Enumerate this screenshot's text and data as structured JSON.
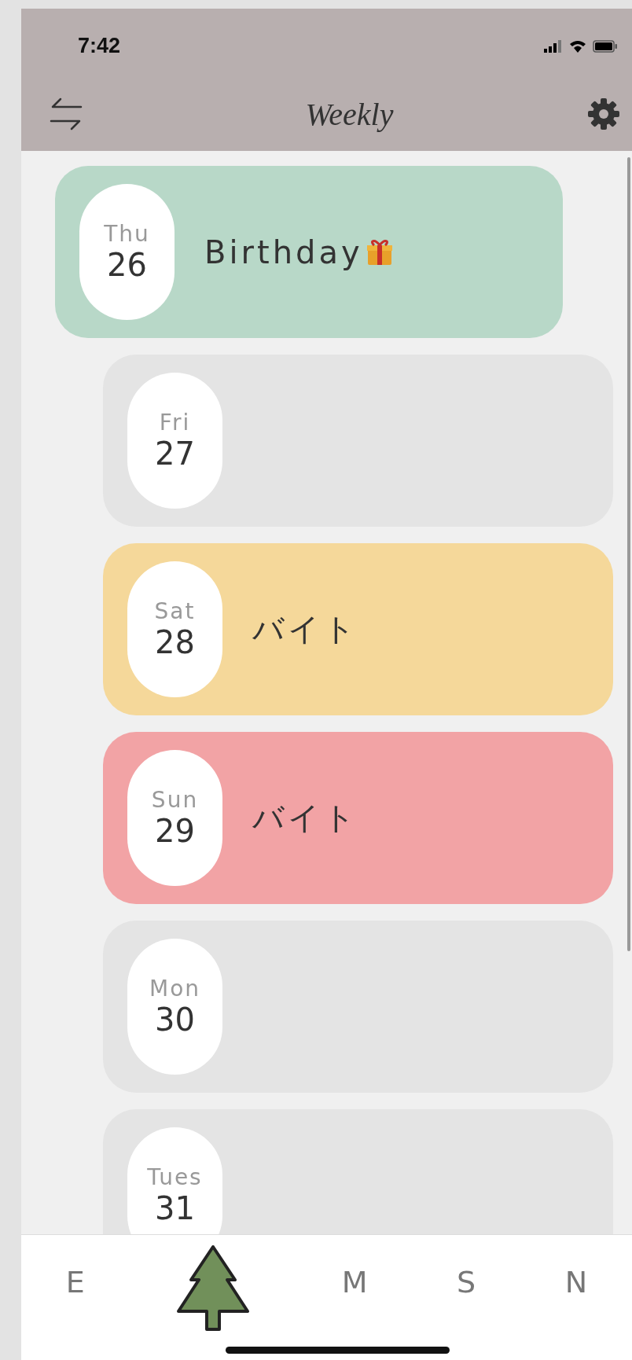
{
  "status_bar": {
    "time": "7:42"
  },
  "header": {
    "title": "Weekly"
  },
  "days": [
    {
      "day": "Thu",
      "date": "26",
      "note": "Birthday",
      "gift": true,
      "color": "#b8d8c8",
      "selected": true
    },
    {
      "day": "Fri",
      "date": "27",
      "color": "#e4e4e4",
      "selected": false
    },
    {
      "day": "Sat",
      "date": "28",
      "note": "バイト",
      "color": "#f5d89a",
      "selected": false
    },
    {
      "day": "Sun",
      "date": "29",
      "note": "バイト",
      "color": "#f2a3a5",
      "selected": false
    },
    {
      "day": "Mon",
      "date": "30",
      "color": "#e4e4e4",
      "selected": false
    },
    {
      "day": "Tues",
      "date": "31",
      "color": "#e4e4e4",
      "selected": false
    }
  ],
  "tabs": [
    {
      "kind": "letter",
      "label": "E",
      "selected": false
    },
    {
      "kind": "tree",
      "selected": true
    },
    {
      "kind": "letter",
      "label": "M",
      "selected": false
    },
    {
      "kind": "letter",
      "label": "S",
      "selected": false
    },
    {
      "kind": "letter",
      "label": "N",
      "selected": false
    }
  ]
}
